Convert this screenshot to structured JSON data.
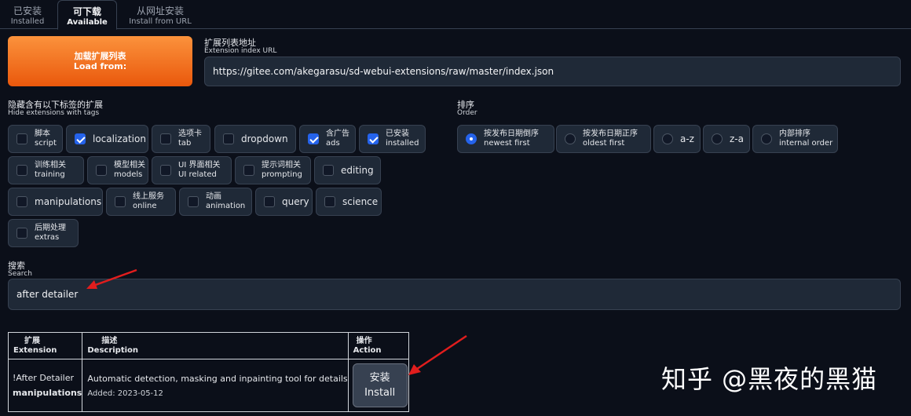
{
  "tabs": [
    {
      "zh": "已安装",
      "en": "Installed",
      "active": false
    },
    {
      "zh": "可下载",
      "en": "Available",
      "active": true
    },
    {
      "zh": "从网址安装",
      "en": "Install from URL",
      "active": false
    }
  ],
  "load_button": {
    "zh": "加载扩展列表",
    "en": "Load from:"
  },
  "index_url": {
    "label_zh": "扩展列表地址",
    "label_en": "Extension index URL",
    "value": "https://gitee.com/akegarasu/sd-webui-extensions/raw/master/index.json"
  },
  "hide_tags": {
    "label_zh": "隐藏含有以下标签的扩展",
    "label_en": "Hide extensions with tags",
    "items": [
      {
        "zh": "脚本",
        "en": "script",
        "checked": false
      },
      {
        "zh": "",
        "en": "localization",
        "checked": true
      },
      {
        "zh": "选项卡",
        "en": "tab",
        "checked": false
      },
      {
        "zh": "",
        "en": "dropdown",
        "checked": false
      },
      {
        "zh": "含广告",
        "en": "ads",
        "checked": true
      },
      {
        "zh": "已安装",
        "en": "installed",
        "checked": true
      },
      {
        "zh": "训练相关",
        "en": "training",
        "checked": false
      },
      {
        "zh": "模型相关",
        "en": "models",
        "checked": false
      },
      {
        "zh": "UI 界面相关",
        "en": "UI related",
        "checked": false
      },
      {
        "zh": "提示词相关",
        "en": "prompting",
        "checked": false
      },
      {
        "zh": "",
        "en": "editing",
        "checked": false
      },
      {
        "zh": "",
        "en": "manipulations",
        "checked": false
      },
      {
        "zh": "线上服务",
        "en": "online",
        "checked": false
      },
      {
        "zh": "动画",
        "en": "animation",
        "checked": false
      },
      {
        "zh": "",
        "en": "query",
        "checked": false
      },
      {
        "zh": "",
        "en": "science",
        "checked": false
      },
      {
        "zh": "后期处理",
        "en": "extras",
        "checked": false
      }
    ]
  },
  "order": {
    "label_zh": "排序",
    "label_en": "Order",
    "items": [
      {
        "zh": "按发布日期倒序",
        "en": "newest first",
        "selected": true
      },
      {
        "zh": "按发布日期正序",
        "en": "oldest first",
        "selected": false
      },
      {
        "zh": "",
        "en": "a-z",
        "selected": false
      },
      {
        "zh": "",
        "en": "z-a",
        "selected": false
      },
      {
        "zh": "内部排序",
        "en": "internal order",
        "selected": false
      }
    ]
  },
  "search": {
    "label_zh": "搜索",
    "label_en": "Search",
    "value": "after detailer"
  },
  "table": {
    "headers": [
      {
        "zh": "扩展",
        "en": "Extension"
      },
      {
        "zh": "描述",
        "en": "Description"
      },
      {
        "zh": "操作",
        "en": "Action"
      }
    ],
    "rows": [
      {
        "name": "!After Detailer",
        "tag": "manipulations",
        "description": "Automatic detection, masking and inpainting tool for details",
        "added": "Added: 2023-05-12",
        "action_zh": "安装",
        "action_en": "Install"
      }
    ]
  },
  "watermark": "知乎 @黑夜的黑猫",
  "colors": {
    "accent": "#ea580c",
    "checkbox": "#2563eb",
    "arrow": "#e11d1d",
    "background": "#0b0f19"
  }
}
